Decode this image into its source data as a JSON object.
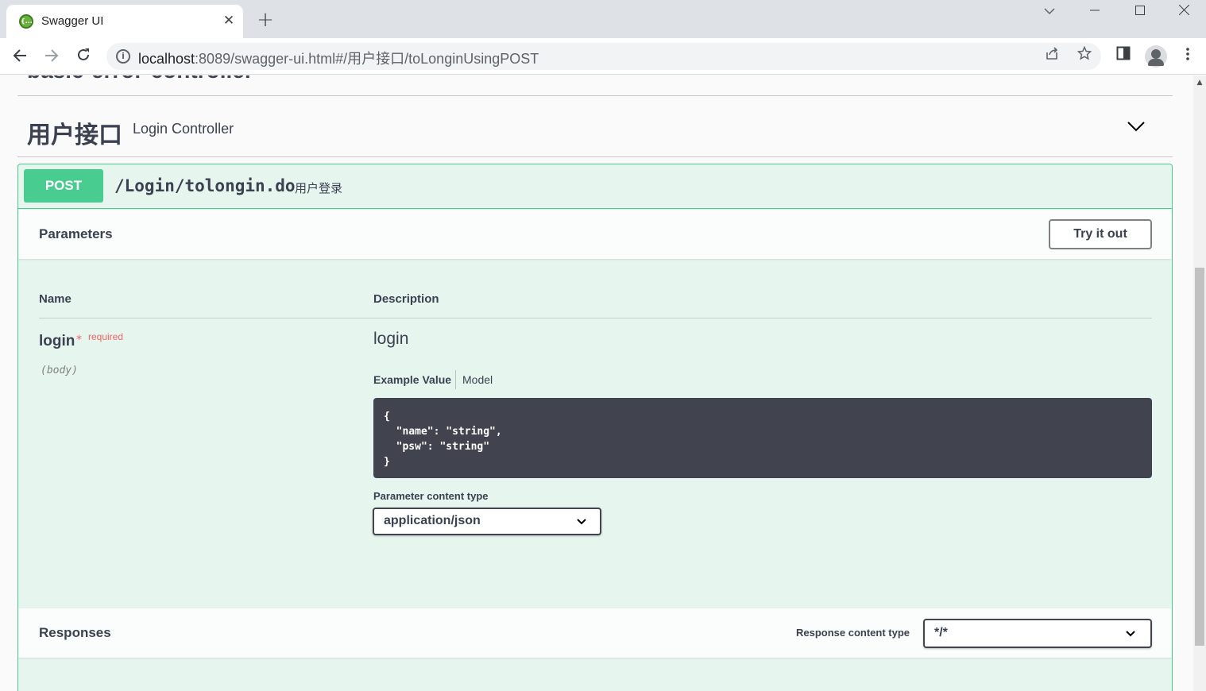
{
  "browser": {
    "tab_title": "Swagger UI",
    "tab_favicon": "{...}",
    "url_host": "localhost",
    "url_path": ":8089/swagger-ui.html#/用户接口/toLonginUsingPOST",
    "icons": [
      "back-icon",
      "forward-icon",
      "reload-icon",
      "info-icon",
      "share-icon",
      "star-icon",
      "side-panel-icon",
      "profile-icon",
      "menu-icon"
    ]
  },
  "page": {
    "prev_tag_partial": "basic-error-controller",
    "tag": {
      "name": "用户接口",
      "description": "Login Controller"
    },
    "operation": {
      "method": "POST",
      "path": "/Login/tolongin.do",
      "summary": "用户登录",
      "parameters_title": "Parameters",
      "try_it_out_label": "Try it out",
      "col_name": "Name",
      "col_description": "Description",
      "param": {
        "name": "login",
        "star": "*",
        "required_label": "required",
        "in": "(body)",
        "description": "login"
      },
      "example_tab": "Example Value",
      "model_tab": "Model",
      "example_code": "{\n  \"name\": \"string\",\n  \"psw\": \"string\"\n}",
      "param_content_type_label": "Parameter content type",
      "param_content_type_value": "application/json",
      "responses_title": "Responses",
      "response_content_type_label": "Response content type",
      "response_content_type_value": "*/*"
    }
  },
  "colors": {
    "post": "#49cc90",
    "text": "#3b4151",
    "code_bg": "#41444e"
  }
}
